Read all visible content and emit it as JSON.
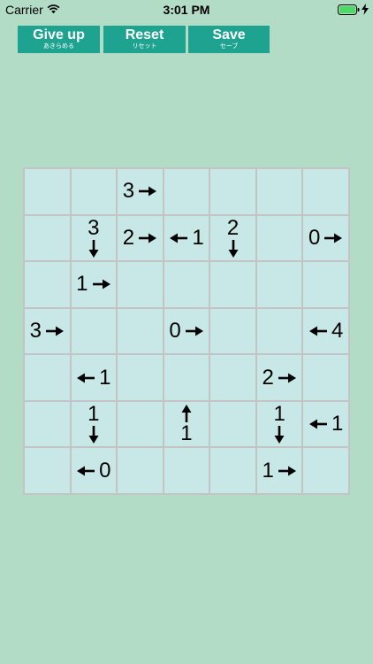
{
  "status_bar": {
    "carrier": "Carrier",
    "time": "3:01 PM"
  },
  "toolbar": {
    "give_up_label": "Give up",
    "give_up_sub": "あきらめる",
    "reset_label": "Reset",
    "reset_sub": "リセット",
    "save_label": "Save",
    "save_sub": "セーブ"
  },
  "colors": {
    "background": "#b2dcc6",
    "button": "#1fa391",
    "cell": "#c8e8e8",
    "grid_line": "#c4c4c4"
  },
  "board": {
    "size": 7,
    "cells": [
      [
        null,
        null,
        {
          "n": "3",
          "dir": "right"
        },
        null,
        null,
        null,
        null
      ],
      [
        null,
        {
          "n": "3",
          "dir": "down"
        },
        {
          "n": "2",
          "dir": "right"
        },
        {
          "n": "1",
          "dir": "left"
        },
        {
          "n": "2",
          "dir": "down"
        },
        null,
        {
          "n": "0",
          "dir": "right"
        }
      ],
      [
        null,
        {
          "n": "1",
          "dir": "right"
        },
        null,
        null,
        null,
        null,
        null
      ],
      [
        {
          "n": "3",
          "dir": "right"
        },
        null,
        null,
        {
          "n": "0",
          "dir": "right"
        },
        null,
        null,
        {
          "n": "4",
          "dir": "left"
        }
      ],
      [
        null,
        {
          "n": "1",
          "dir": "left"
        },
        null,
        null,
        null,
        {
          "n": "2",
          "dir": "right"
        },
        null
      ],
      [
        null,
        {
          "n": "1",
          "dir": "down"
        },
        null,
        {
          "n": "1",
          "dir": "up"
        },
        null,
        {
          "n": "1",
          "dir": "down"
        },
        {
          "n": "1",
          "dir": "left"
        }
      ],
      [
        null,
        {
          "n": "0",
          "dir": "left"
        },
        null,
        null,
        null,
        {
          "n": "1",
          "dir": "right"
        },
        null
      ]
    ]
  }
}
